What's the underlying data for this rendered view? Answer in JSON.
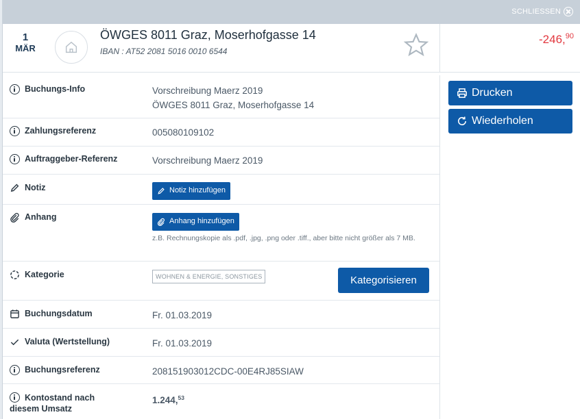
{
  "topbar": {
    "close_label": "SCHLIESSEN"
  },
  "transaction": {
    "day": "1",
    "month": "MÄR",
    "title": "ÖWGES 8011 Graz, Moserhofgasse 14",
    "iban": "IBAN : AT52 2081 5016 0010 6544",
    "amount_main": "-246,",
    "amount_cents": "90"
  },
  "details": {
    "buchungsinfo_label": "Buchungs-Info",
    "buchungsinfo_line1": "Vorschreibung Maerz 2019",
    "buchungsinfo_line2": "ÖWGES 8011 Graz, Moserhofgasse 14",
    "zahlungsref_label": "Zahlungsreferenz",
    "zahlungsref_value": "005080109102",
    "auftraggeber_label": "Auftraggeber-Referenz",
    "auftraggeber_value": "Vorschreibung Maerz 2019",
    "notiz_label": "Notiz",
    "notiz_button": "Notiz hinzufügen",
    "anhang_label": "Anhang",
    "anhang_button": "Anhang hinzufügen",
    "anhang_hint": "z.B. Rechnungskopie als .pdf, .jpg, .png oder .tiff., aber bitte nicht größer als 7 MB.",
    "kategorie_label": "Kategorie",
    "kategorie_tag": "WOHNEN & ENERGIE, SONSTIGES",
    "kategorie_button": "Kategorisieren",
    "buchungsdatum_label": "Buchungsdatum",
    "buchungsdatum_value": "Fr. 01.03.2019",
    "valuta_label": "Valuta (Wertstellung)",
    "valuta_value": "Fr. 01.03.2019",
    "buchungsref_label": "Buchungsreferenz",
    "buchungsref_value": "208151903012CDC-00E4RJ85SIAW",
    "kontostand_label_1": "Kontostand nach",
    "kontostand_label_2": "diesem Umsatz",
    "kontostand_main": "1.244,",
    "kontostand_cents": "53"
  },
  "actions": {
    "print_label": "Drucken",
    "repeat_label": "Wiederholen"
  },
  "colors": {
    "accent": "#0e5aa7",
    "negative": "#e2383f",
    "positive": "#1c9a3f"
  },
  "icons": [
    "close-icon",
    "house-icon",
    "star-icon",
    "info-icon",
    "pencil-icon",
    "paperclip-icon",
    "category-icon",
    "calendar-icon",
    "check-icon",
    "printer-icon",
    "repeat-icon"
  ]
}
